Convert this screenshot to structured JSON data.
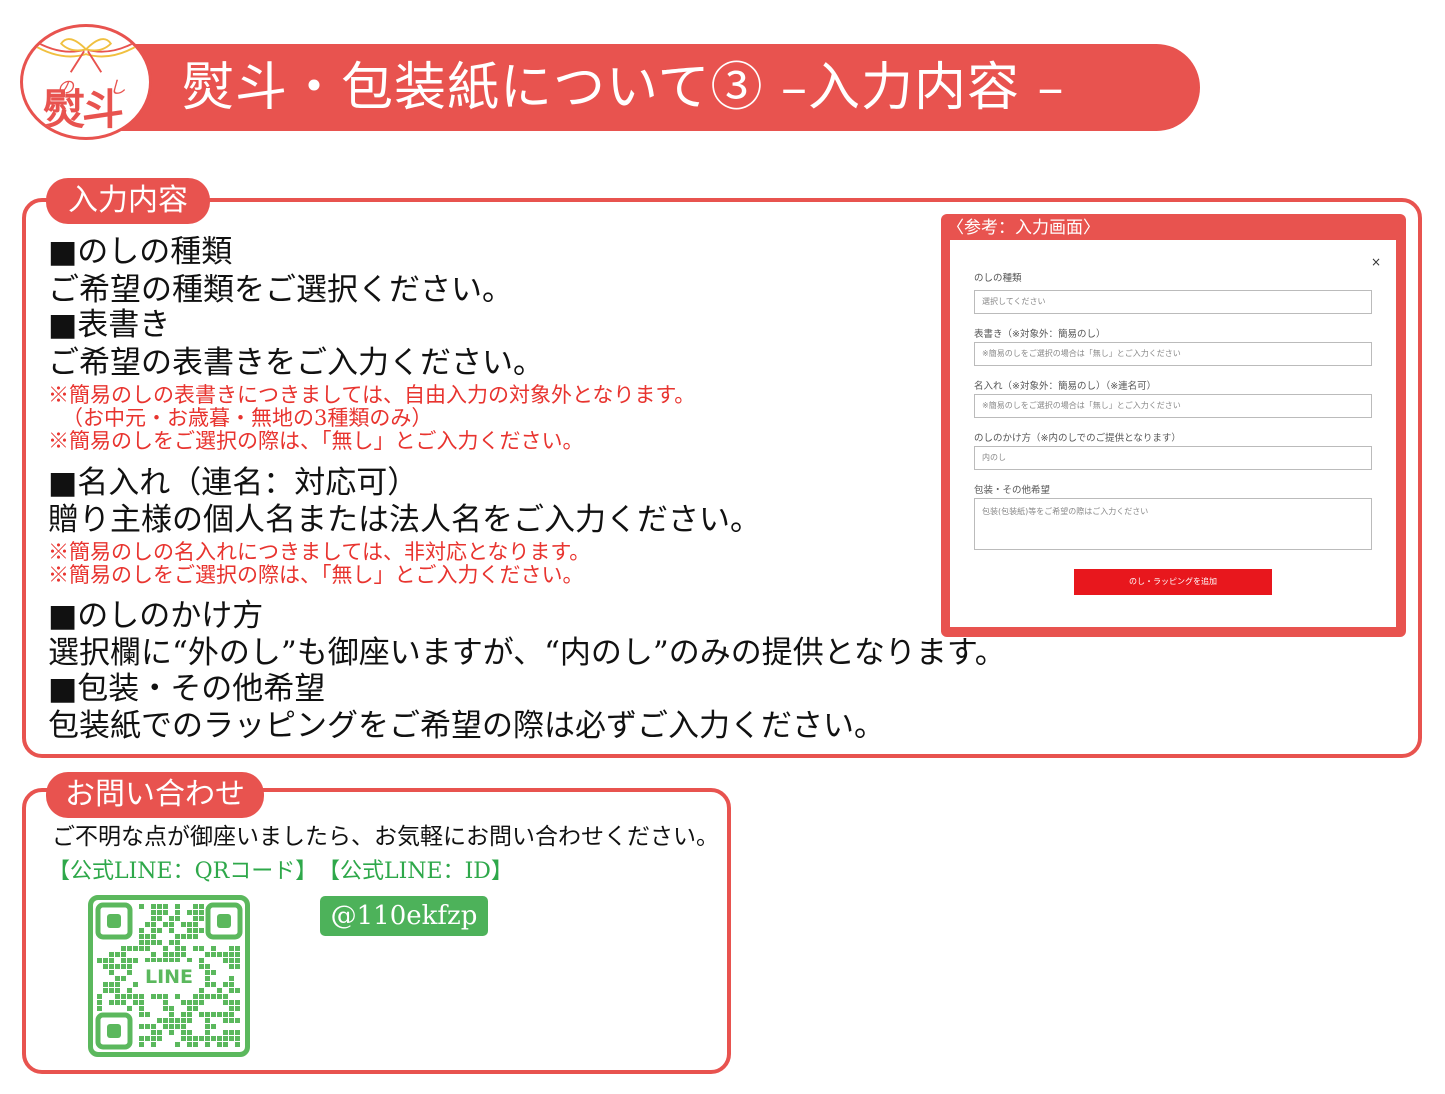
{
  "header": {
    "title": "熨斗・包装紙について③ –入力内容 –",
    "badge_small_left": "の",
    "badge_small_right": "し",
    "badge_main": "熨斗",
    "accent_color": "#e8534f"
  },
  "input_section": {
    "tag": "入力内容",
    "noshi_type": {
      "heading": "■のしの種類",
      "body": "ご希望の種類をご選択ください。"
    },
    "omotegaki": {
      "heading": "■表書き",
      "body": "ご希望の表書きをご入力ください。",
      "notes": [
        "※簡易のしの表書きにつきましては、自由入力の対象外となります。",
        "（お中元・お歳暮・無地の3種類のみ）",
        "※簡易のしをご選択の際は、「無し」とご入力ください。"
      ]
    },
    "naire": {
      "heading": "■名入れ（連名：対応可）",
      "body": "贈り主様の個人名または法人名をご入力ください。",
      "notes": [
        "※簡易のしの名入れにつきましては、非対応となります。",
        "※簡易のしをご選択の際は、「無し」とご入力ください。"
      ]
    },
    "kakekata": {
      "heading": "■のしのかけ方",
      "body": "選択欄に“外のし”も御座いますが、“内のし”のみの提供となります。"
    },
    "wrapping": {
      "heading": "■包装・その他希望",
      "body": "包装紙でのラッピングをご希望の際は必ずご入力ください。"
    }
  },
  "reference_form": {
    "title": "〈参考：入力画面〉",
    "close": "×",
    "fields": [
      {
        "label": "のしの種類",
        "value": "選択してください"
      },
      {
        "label": "表書き（※対象外：簡易のし）",
        "value": "※簡易のしをご選択の場合は「無し」とご入力ください"
      },
      {
        "label": "名入れ（※対象外：簡易のし）（※連名可）",
        "value": "※簡易のしをご選択の場合は「無し」とご入力ください"
      },
      {
        "label": "のしのかけ方（※内のしでのご提供となります）",
        "value": "内のし"
      },
      {
        "label": "包装・その他希望",
        "value": "包装(包装紙)等をご希望の際はご入力ください"
      }
    ],
    "submit_label": "のし・ラッピングを追加",
    "button_color": "#e8171d"
  },
  "contact_section": {
    "tag": "お問い合わせ",
    "text": "ご不明な点が御座いましたら、お気軽にお問い合わせください。",
    "qr_label": "【公式LINE：QRコード】",
    "id_label": "【公式LINE：ID】",
    "line_id": "@110ekfzp",
    "qr_center_text": "LINE",
    "line_color": "#4db25a"
  }
}
